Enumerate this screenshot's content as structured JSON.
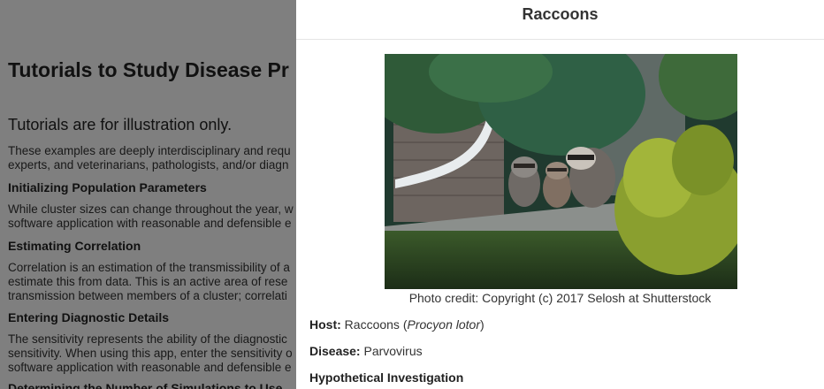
{
  "background": {
    "title": "Tutorials to Study Disease Pr",
    "subtitle": "Tutorials are for illustration only.",
    "intro": [
      "These examples are deeply interdisciplinary and requ",
      "experts, and veterinarians, pathologists, and/or diagn"
    ],
    "sections": [
      {
        "heading": "Initializing Population Parameters",
        "lines": [
          "While cluster sizes can change throughout the year, w",
          "software application with reasonable and defensible e"
        ]
      },
      {
        "heading": "Estimating Correlation",
        "lines": [
          "Correlation is an estimation of the transmissibility of a",
          "estimate this from data. This is an active area of rese",
          "transmission between members of a cluster; correlati"
        ]
      },
      {
        "heading": "Entering Diagnostic Details",
        "lines": [
          "The sensitivity represents the ability of the diagnostic",
          "sensitivity. When using this app, enter the sensitivity o",
          "software application with reasonable and defensible e"
        ]
      },
      {
        "heading": "Determining the Number of Simulations to Use",
        "lines": []
      }
    ]
  },
  "modal": {
    "title": "Raccoons",
    "caption": "Photo credit: Copyright (c) 2017 Selosh at Shutterstock",
    "host_label": "Host:",
    "host_name": "Raccoons",
    "host_latin": "Procyon lotor",
    "disease_label": "Disease:",
    "disease_value": "Parvovirus",
    "investigation_heading": "Hypothetical Investigation"
  }
}
